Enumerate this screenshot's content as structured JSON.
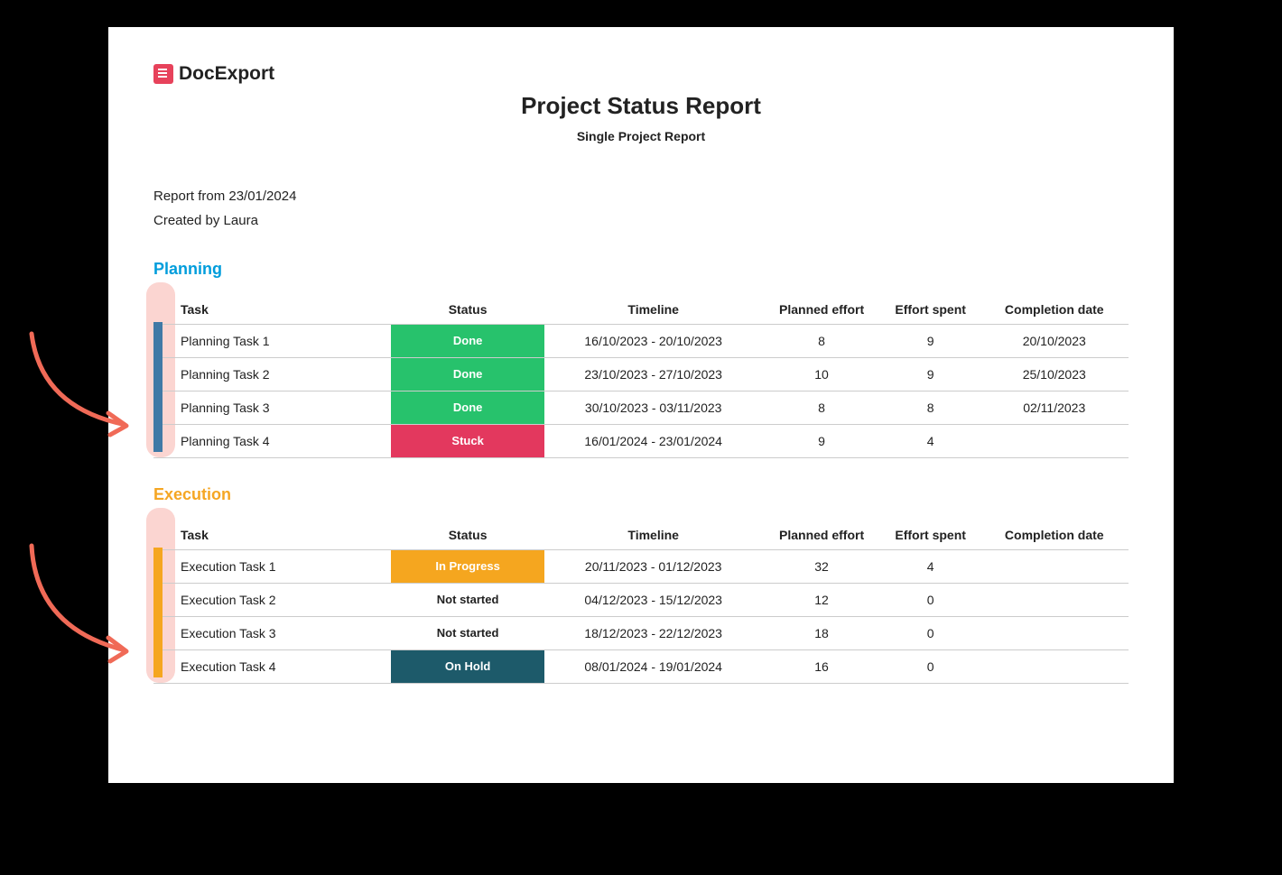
{
  "brand": "DocExport",
  "title": "Project Status Report",
  "subtitle": "Single Project Report",
  "meta": {
    "report_from": "Report from 23/01/2024",
    "created_by": "Created by Laura"
  },
  "columns": {
    "task": "Task",
    "status": "Status",
    "timeline": "Timeline",
    "planned_effort": "Planned effort",
    "effort_spent": "Effort spent",
    "completion_date": "Completion date"
  },
  "sections": [
    {
      "name": "Planning",
      "color_class": "blue",
      "stripe_class": "blue",
      "rows": [
        {
          "task": "Planning Task 1",
          "status": "Done",
          "status_class": "done",
          "timeline": "16/10/2023 - 20/10/2023",
          "planned": "8",
          "spent": "9",
          "completion": "20/10/2023"
        },
        {
          "task": "Planning Task 2",
          "status": "Done",
          "status_class": "done",
          "timeline": "23/10/2023 - 27/10/2023",
          "planned": "10",
          "spent": "9",
          "completion": "25/10/2023"
        },
        {
          "task": "Planning Task 3",
          "status": "Done",
          "status_class": "done",
          "timeline": "30/10/2023 - 03/11/2023",
          "planned": "8",
          "spent": "8",
          "completion": "02/11/2023"
        },
        {
          "task": "Planning Task 4",
          "status": "Stuck",
          "status_class": "stuck",
          "timeline": "16/01/2024 - 23/01/2024",
          "planned": "9",
          "spent": "4",
          "completion": ""
        }
      ]
    },
    {
      "name": "Execution",
      "color_class": "orange",
      "stripe_class": "orange",
      "rows": [
        {
          "task": "Execution Task 1",
          "status": "In Progress",
          "status_class": "inprogress",
          "timeline": "20/11/2023 - 01/12/2023",
          "planned": "32",
          "spent": "4",
          "completion": ""
        },
        {
          "task": "Execution Task 2",
          "status": "Not started",
          "status_class": "notstarted",
          "timeline": "04/12/2023 - 15/12/2023",
          "planned": "12",
          "spent": "0",
          "completion": ""
        },
        {
          "task": "Execution Task 3",
          "status": "Not started",
          "status_class": "notstarted",
          "timeline": "18/12/2023 - 22/12/2023",
          "planned": "18",
          "spent": "0",
          "completion": ""
        },
        {
          "task": "Execution Task 4",
          "status": "On Hold",
          "status_class": "onhold",
          "timeline": "08/01/2024 - 19/01/2024",
          "planned": "16",
          "spent": "0",
          "completion": ""
        }
      ]
    }
  ]
}
